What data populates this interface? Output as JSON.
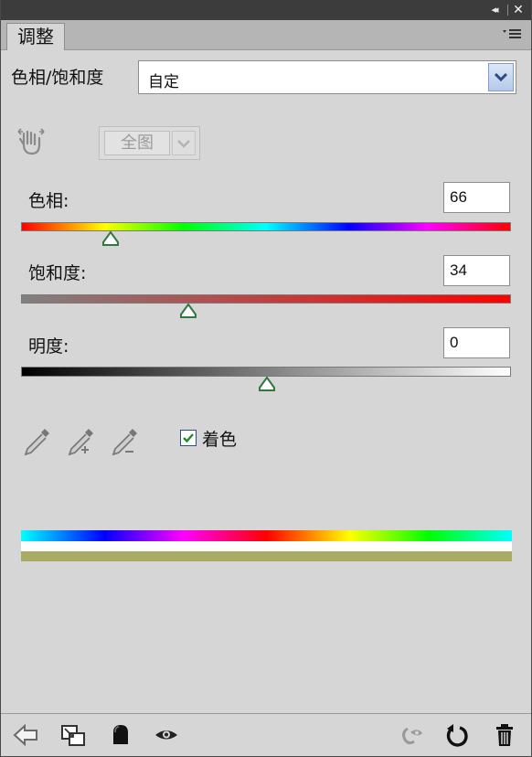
{
  "panel": {
    "tab_label": "调整",
    "collapse_glyph": "◂◂",
    "close_glyph": "✕"
  },
  "preset": {
    "label": "色相/饱和度",
    "value": "自定"
  },
  "channel": {
    "value": "全图"
  },
  "hue": {
    "label": "色相:",
    "value": "66"
  },
  "saturation": {
    "label": "饱和度:",
    "value": "34"
  },
  "lightness": {
    "label": "明度:",
    "value": "0"
  },
  "colorize": {
    "label": "着色",
    "checked": true
  },
  "colors": {
    "accent": "#7f9dcf",
    "thumb_green": "#2f7a3c",
    "result_tint": "#a7ab63"
  },
  "icons": {
    "targeted_adjust": "hand-icon",
    "eyedropper": "eyedropper-icon",
    "eyedropper_add": "eyedropper-plus-icon",
    "eyedropper_subtract": "eyedropper-minus-icon",
    "back": "arrow-left-icon",
    "clip": "clip-to-layer-icon",
    "mask": "mask-icon",
    "visibility": "eye-icon",
    "previous_state": "previous-state-icon",
    "reset": "reset-icon",
    "delete": "trash-icon"
  }
}
